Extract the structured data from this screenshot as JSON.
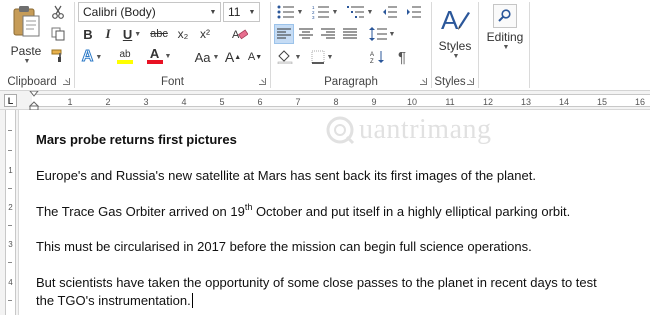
{
  "ribbon": {
    "clipboard": {
      "group_label": "Clipboard",
      "paste_label": "Paste"
    },
    "font": {
      "group_label": "Font",
      "font_name": "Calibri (Body)",
      "font_size": "11",
      "bold": "B",
      "italic": "I",
      "underline": "U",
      "strikethrough": "abc",
      "subscript": "x₂",
      "superscript": "x²",
      "grow": "A",
      "shrink": "A",
      "change_case": "Aa",
      "text_effects": "A",
      "highlight": "ab",
      "font_color": "A"
    },
    "paragraph": {
      "group_label": "Paragraph",
      "pilcrow": "¶"
    },
    "styles": {
      "group_label": "Styles",
      "styles_label": "Styles"
    },
    "editing": {
      "editing_label": "Editing"
    }
  },
  "ruler": {
    "tab_selector": "L",
    "numbers": [
      "1",
      "2",
      "3",
      "4",
      "5",
      "6",
      "7",
      "8",
      "9",
      "10",
      "11",
      "12",
      "13",
      "14",
      "15",
      "16"
    ],
    "vertical_numbers": [
      "1",
      "2",
      "3",
      "4"
    ]
  },
  "document": {
    "watermark": "uantrimang",
    "title": "Mars probe returns first pictures",
    "p1": "Europe's and Russia's new satellite at Mars has sent back its first images of the planet.",
    "p2_before": "The Trace Gas Orbiter arrived on 19",
    "p2_sup": "th",
    "p2_after": " October and put itself in a highly elliptical parking orbit.",
    "p3": "This must be circularised in 2017 before the mission can begin full science operations.",
    "p4_line1": "But scientists have taken the opportunity of some close passes to the planet in recent days to test",
    "p4_line2": "the TGO's instrumentation."
  },
  "colors": {
    "accent": "#2b579a",
    "highlight": "#ffff00",
    "font_color": "#e81123",
    "selected_button": "#c5dcf5"
  }
}
